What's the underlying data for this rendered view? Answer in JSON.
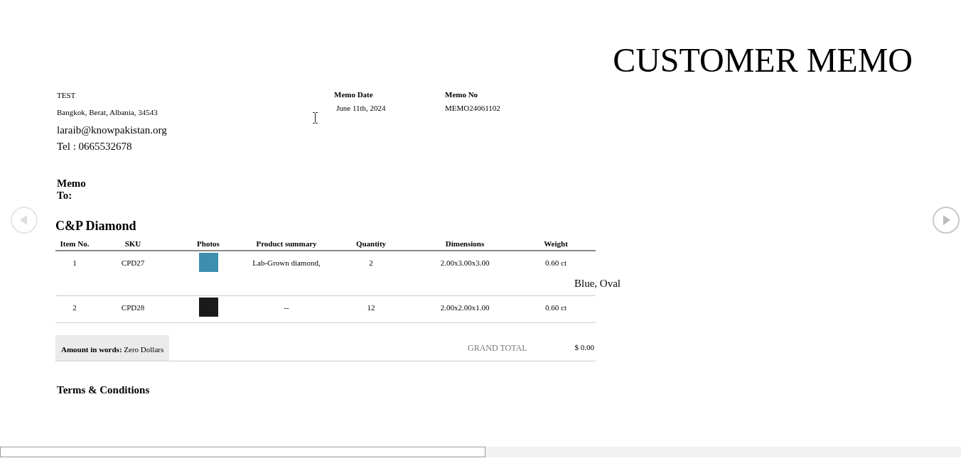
{
  "title": "CUSTOMER MEMO",
  "sender": {
    "name": "TEST",
    "address": "Bangkok, Berat, Albania, 34543",
    "email": "laraib@knowpakistan.org",
    "phone": "Tel : 0665532678"
  },
  "memo_info": [
    {
      "label": "Memo Date",
      "value": "June 11th, 2024"
    },
    {
      "label": "Memo No",
      "value": "MEMO24061102"
    }
  ],
  "memo_to": {
    "label": "Memo To:",
    "company": "C&P Diamond"
  },
  "table": {
    "columns": [
      "Item No.",
      "SKU",
      "Photos",
      "Product summary",
      "Quantity",
      "Dimensions",
      "Weight"
    ],
    "rows": [
      {
        "item_no": "1",
        "sku": "CPD27",
        "product_summary": "Lab-Grown diamond,",
        "summary_overflow": "Blue, Oval",
        "quantity": "2",
        "dimensions": "2.00x3.00x3.00",
        "weight": "0.60 ct"
      },
      {
        "item_no": "2",
        "sku": "CPD28",
        "product_summary": "--",
        "quantity": "12",
        "dimensions": "2.00x2.00x1.00",
        "weight": "0.60 ct"
      }
    ]
  },
  "amount_in_words": {
    "label": "Amount in words:",
    "value": "Zero Dollars"
  },
  "grand_total": {
    "label": "GRAND TOTAL",
    "value": "$ 0.00"
  },
  "terms_heading": "Terms & Conditions"
}
